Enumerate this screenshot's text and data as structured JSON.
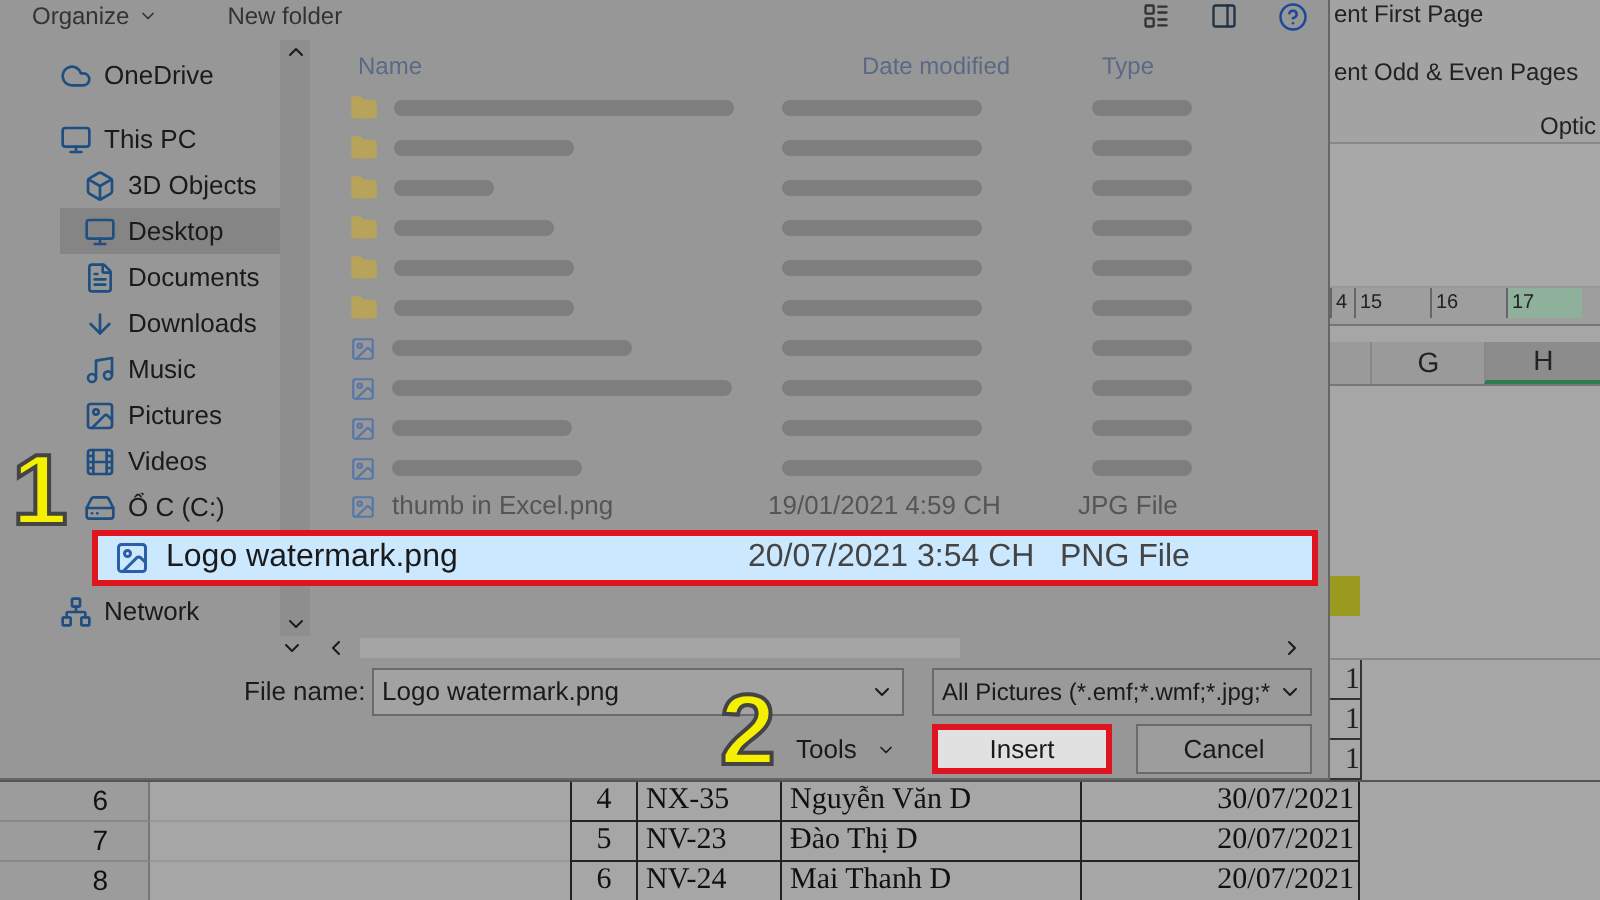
{
  "dialog": {
    "toolbar": {
      "organize": "Organize",
      "new_folder": "New folder"
    },
    "sidebar": {
      "items": [
        {
          "label": "OneDrive",
          "selected": false,
          "indent": false
        },
        {
          "label": "This PC",
          "selected": false,
          "indent": false
        },
        {
          "label": "3D Objects",
          "selected": false,
          "indent": true
        },
        {
          "label": "Desktop",
          "selected": true,
          "indent": true
        },
        {
          "label": "Documents",
          "selected": false,
          "indent": true
        },
        {
          "label": "Downloads",
          "selected": false,
          "indent": true
        },
        {
          "label": "Music",
          "selected": false,
          "indent": true
        },
        {
          "label": "Pictures",
          "selected": false,
          "indent": true
        },
        {
          "label": "Videos",
          "selected": false,
          "indent": true
        },
        {
          "label": "Ổ C (C:)",
          "selected": false,
          "indent": true
        },
        {
          "label": "Network",
          "selected": false,
          "indent": false
        }
      ]
    },
    "columns": [
      "Name",
      "Date modified",
      "Type"
    ],
    "blurred_rows": [
      {
        "kind": "folder"
      },
      {
        "kind": "folder"
      },
      {
        "kind": "folder"
      },
      {
        "kind": "folder"
      },
      {
        "kind": "folder"
      },
      {
        "kind": "folder"
      },
      {
        "kind": "image"
      },
      {
        "kind": "image"
      },
      {
        "kind": "image"
      },
      {
        "kind": "image"
      }
    ],
    "dim_row": {
      "name": "thumb in Excel.png",
      "date": "19/01/2021 4:59 CH",
      "type": "JPG File"
    },
    "highlighted_row": {
      "name": "Logo watermark.png",
      "date": "20/07/2021 3:54 CH",
      "type": "PNG File",
      "selected": true
    },
    "file_name_label": "File name:",
    "file_name": "Logo watermark.png",
    "filter": "All Pictures (*.emf;*.wmf;*.jpg;*",
    "tools": "Tools",
    "insert": "Insert",
    "cancel": "Cancel"
  },
  "excel": {
    "ribbon": [
      "ent First Page",
      "ent Odd & Even Pages"
    ],
    "group_label": "Optic",
    "ruler": [
      "4",
      "15",
      "16",
      "17"
    ],
    "columns": [
      {
        "label": "G",
        "selected": false
      },
      {
        "label": "H",
        "selected": true
      }
    ],
    "cut_cells": [
      "1",
      "1",
      "1"
    ],
    "rows": [
      {
        "row": "6",
        "cells": [
          "4",
          "NX-35",
          "Nguyễn Văn D",
          "30/07/2021"
        ]
      },
      {
        "row": "7",
        "cells": [
          "5",
          "NV-23",
          "Đào Thị D",
          "20/07/2021"
        ]
      },
      {
        "row": "8",
        "cells": [
          "6",
          "NV-24",
          "Mai Thanh D",
          "20/07/2021"
        ]
      }
    ]
  },
  "annotations": [
    "1",
    "2"
  ]
}
